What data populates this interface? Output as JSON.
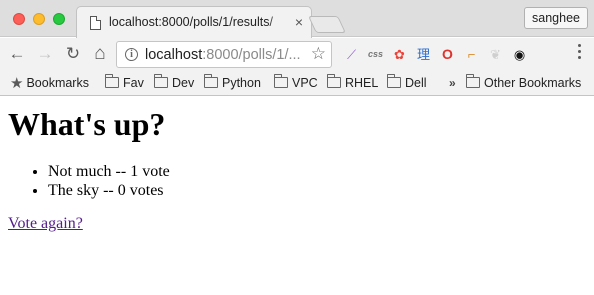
{
  "browser": {
    "tab": {
      "title": "localhost:8000/polls/1/results/",
      "close": "×"
    },
    "profile_label": "sanghee",
    "nav": {
      "back": "←",
      "forward": "→",
      "reload": "↻",
      "home": "⌂"
    },
    "omnibox": {
      "url_host": "localhost",
      "url_rest": ":8000/polls/1/...",
      "info": "i",
      "star": "☆"
    },
    "extensions": [
      {
        "name": "feather-extension-icon",
        "glyph": "⟋",
        "color": "#9b5fd6"
      },
      {
        "name": "css-extension-icon",
        "glyph": "css",
        "color": "#777777"
      },
      {
        "name": "color-wheel-extension-icon",
        "glyph": "✿",
        "color": "#e8453c"
      },
      {
        "name": "kanji-extension-icon",
        "glyph": "理",
        "color": "#2f6fcf"
      },
      {
        "name": "opera-extension-icon",
        "glyph": "O",
        "color": "#e0332d"
      },
      {
        "name": "stamp-extension-icon",
        "glyph": "⌐",
        "color": "#d98b2a"
      },
      {
        "name": "feather-grey-extension-icon",
        "glyph": "❦",
        "color": "#cfcfcf"
      },
      {
        "name": "eye-extension-icon",
        "glyph": "◉",
        "color": "#111111"
      }
    ],
    "bookmarks": {
      "items": [
        "Bookmarks",
        "Fav",
        "Dev",
        "Python",
        "VPC",
        "RHEL",
        "Dell"
      ],
      "overflow": "»",
      "other": "Other Bookmarks"
    }
  },
  "page": {
    "heading": "What's up?",
    "results": [
      "Not much -- 1 vote",
      "The sky -- 0 votes"
    ],
    "vote_again_link": "Vote again?"
  }
}
